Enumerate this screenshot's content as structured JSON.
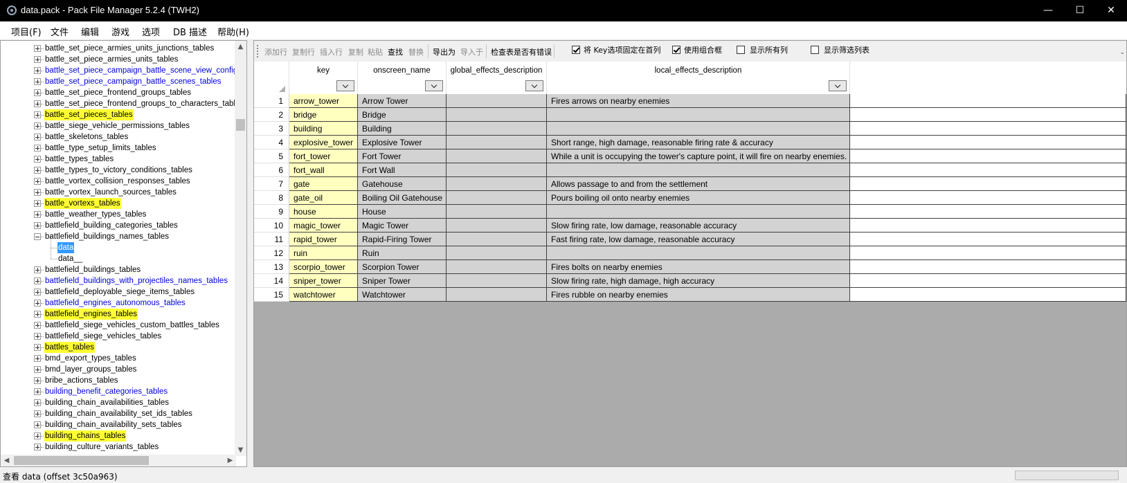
{
  "window": {
    "title": "data.pack - Pack File Manager 5.2.4 (TWH2)",
    "minimize": "—",
    "maximize": "☐",
    "close": "✕"
  },
  "menu": [
    "项目(F)",
    "文件",
    "编辑",
    "游戏",
    "选项",
    "DB 描述",
    "帮助(H)"
  ],
  "tree": {
    "items": [
      {
        "label": "battle_set_piece_armies_units_junctions_tables",
        "style": "normal",
        "expander": "plus"
      },
      {
        "label": "battle_set_piece_armies_units_tables",
        "style": "normal",
        "expander": "plus"
      },
      {
        "label": "battle_set_piece_campaign_battle_scene_view_configura",
        "style": "blue",
        "expander": "plus"
      },
      {
        "label": "battle_set_piece_campaign_battle_scenes_tables",
        "style": "blue",
        "expander": "plus"
      },
      {
        "label": "battle_set_piece_frontend_groups_tables",
        "style": "normal",
        "expander": "plus"
      },
      {
        "label": "battle_set_piece_frontend_groups_to_characters_tables",
        "style": "normal",
        "expander": "plus"
      },
      {
        "label": "battle_set_pieces_tables",
        "style": "highlight",
        "expander": "plus"
      },
      {
        "label": "battle_siege_vehicle_permissions_tables",
        "style": "normal",
        "expander": "plus"
      },
      {
        "label": "battle_skeletons_tables",
        "style": "normal",
        "expander": "plus"
      },
      {
        "label": "battle_type_setup_limits_tables",
        "style": "normal",
        "expander": "plus"
      },
      {
        "label": "battle_types_tables",
        "style": "normal",
        "expander": "plus"
      },
      {
        "label": "battle_types_to_victory_conditions_tables",
        "style": "normal",
        "expander": "plus"
      },
      {
        "label": "battle_vortex_collision_responses_tables",
        "style": "normal",
        "expander": "plus"
      },
      {
        "label": "battle_vortex_launch_sources_tables",
        "style": "normal",
        "expander": "plus"
      },
      {
        "label": "battle_vortexs_tables",
        "style": "highlight",
        "expander": "plus"
      },
      {
        "label": "battle_weather_types_tables",
        "style": "normal",
        "expander": "plus"
      },
      {
        "label": "battlefield_building_categories_tables",
        "style": "normal",
        "expander": "plus"
      },
      {
        "label": "battlefield_buildings_names_tables",
        "style": "normal",
        "expander": "minus"
      },
      {
        "label": "data",
        "style": "selected",
        "expander": "child"
      },
      {
        "label": "data__",
        "style": "normal",
        "expander": "child"
      },
      {
        "label": "battlefield_buildings_tables",
        "style": "normal",
        "expander": "plus"
      },
      {
        "label": "battlefield_buildings_with_projectiles_names_tables",
        "style": "blue",
        "expander": "plus"
      },
      {
        "label": "battlefield_deployable_siege_items_tables",
        "style": "normal",
        "expander": "plus"
      },
      {
        "label": "battlefield_engines_autonomous_tables",
        "style": "blue",
        "expander": "plus"
      },
      {
        "label": "battlefield_engines_tables",
        "style": "highlight",
        "expander": "plus"
      },
      {
        "label": "battlefield_siege_vehicles_custom_battles_tables",
        "style": "normal",
        "expander": "plus"
      },
      {
        "label": "battlefield_siege_vehicles_tables",
        "style": "normal",
        "expander": "plus"
      },
      {
        "label": "battles_tables",
        "style": "highlight",
        "expander": "plus"
      },
      {
        "label": "bmd_export_types_tables",
        "style": "normal",
        "expander": "plus"
      },
      {
        "label": "bmd_layer_groups_tables",
        "style": "normal",
        "expander": "plus"
      },
      {
        "label": "bribe_actions_tables",
        "style": "normal",
        "expander": "plus"
      },
      {
        "label": "building_benefit_categories_tables",
        "style": "blue",
        "expander": "plus"
      },
      {
        "label": "building_chain_availabilities_tables",
        "style": "normal",
        "expander": "plus"
      },
      {
        "label": "building_chain_availability_set_ids_tables",
        "style": "normal",
        "expander": "plus"
      },
      {
        "label": "building_chain_availability_sets_tables",
        "style": "normal",
        "expander": "plus"
      },
      {
        "label": "building_chains_tables",
        "style": "highlight",
        "expander": "plus"
      },
      {
        "label": "building_culture_variants_tables",
        "style": "normal",
        "expander": "plus"
      }
    ]
  },
  "toolbar": {
    "add_row": "添加行",
    "copy_row": "复制行",
    "insert_row": "插入行",
    "copy": "复制",
    "paste": "粘贴",
    "find": "查找",
    "replace": "替换",
    "export": "导出为",
    "import": "导入于",
    "check_errors": "检查表是否有错误",
    "pin_key": "将 Key选项固定在首列",
    "use_combo": "使用组合框",
    "show_all_cols": "显示所有列",
    "show_filter": "显示筛选列表",
    "pin_key_checked": true,
    "use_combo_checked": true,
    "show_all_cols_checked": false,
    "show_filter_checked": false
  },
  "grid": {
    "columns": [
      "key",
      "onscreen_name",
      "global_effects_description",
      "local_effects_description"
    ],
    "rows": [
      {
        "n": "1",
        "key": "arrow_tower",
        "name": "Arrow Tower",
        "global": "",
        "local": "Fires arrows on nearby enemies"
      },
      {
        "n": "2",
        "key": "bridge",
        "name": "Bridge",
        "global": "",
        "local": ""
      },
      {
        "n": "3",
        "key": "building",
        "name": "Building",
        "global": "",
        "local": ""
      },
      {
        "n": "4",
        "key": "explosive_tower",
        "name": "Explosive Tower",
        "global": "",
        "local": "Short range, high damage, reasonable firing rate & accuracy"
      },
      {
        "n": "5",
        "key": "fort_tower",
        "name": "Fort Tower",
        "global": "",
        "local": "While a unit is occupying the tower's capture point, it will fire on nearby enemies."
      },
      {
        "n": "6",
        "key": "fort_wall",
        "name": "Fort Wall",
        "global": "",
        "local": ""
      },
      {
        "n": "7",
        "key": "gate",
        "name": "Gatehouse",
        "global": "",
        "local": "Allows passage to and from the settlement"
      },
      {
        "n": "8",
        "key": "gate_oil",
        "name": "Boiling Oil Gatehouse",
        "global": "",
        "local": "Pours boiling oil onto nearby enemies"
      },
      {
        "n": "9",
        "key": "house",
        "name": "House",
        "global": "",
        "local": ""
      },
      {
        "n": "10",
        "key": "magic_tower",
        "name": "Magic Tower",
        "global": "",
        "local": "Slow firing rate, low damage, reasonable accuracy"
      },
      {
        "n": "11",
        "key": "rapid_tower",
        "name": "Rapid-Firing Tower",
        "global": "",
        "local": "Fast firing rate, low damage, reasonable accuracy"
      },
      {
        "n": "12",
        "key": "ruin",
        "name": "Ruin",
        "global": "",
        "local": ""
      },
      {
        "n": "13",
        "key": "scorpio_tower",
        "name": "Scorpion Tower",
        "global": "",
        "local": "Fires bolts on nearby enemies"
      },
      {
        "n": "14",
        "key": "sniper_tower",
        "name": "Sniper Tower",
        "global": "",
        "local": "Slow firing rate, high damage, high accuracy"
      },
      {
        "n": "15",
        "key": "watchtower",
        "name": "Watchtower",
        "global": "",
        "local": "Fires rubble on nearby enemies"
      }
    ]
  },
  "status": {
    "text": "查看 data (offset 3c50a963)"
  },
  "colors": {
    "key_cell": "#ffffc0",
    "gray_cell": "#d3d3d3",
    "highlight": "#ffff33",
    "link_blue": "#0000e0",
    "selection": "#3399ff"
  }
}
